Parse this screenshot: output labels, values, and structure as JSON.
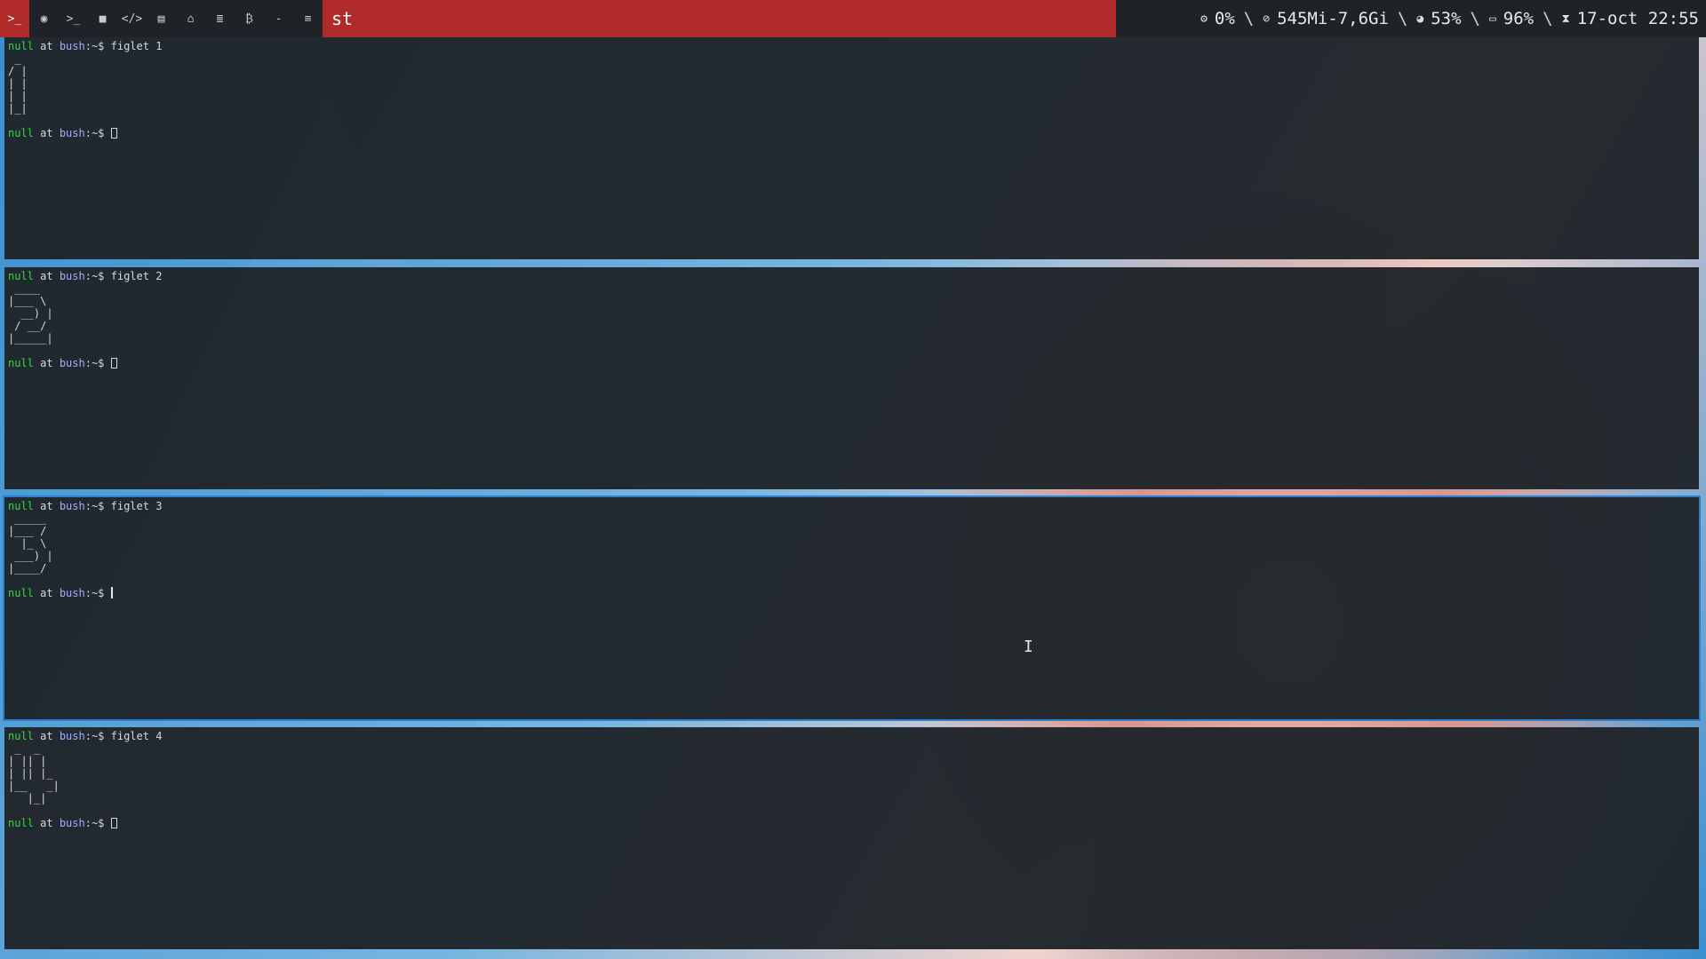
{
  "bar": {
    "tags": [
      {
        "name": "terminal-tag",
        "glyph": ">_",
        "active": true
      },
      {
        "name": "browser-tag",
        "glyph": "◉",
        "active": false
      },
      {
        "name": "shell-tag",
        "glyph": ">_",
        "active": false
      },
      {
        "name": "folder-tag",
        "glyph": "■",
        "active": false
      },
      {
        "name": "code-tag",
        "glyph": "</>",
        "active": false
      },
      {
        "name": "film-tag",
        "glyph": "▤",
        "active": false
      },
      {
        "name": "bank-tag",
        "glyph": "⌂",
        "active": false
      },
      {
        "name": "database-tag",
        "glyph": "≣",
        "active": false
      },
      {
        "name": "bitcoin-tag",
        "glyph": "₿",
        "active": false
      }
    ],
    "layout_symbol": "-",
    "menu_symbol": "≡",
    "window_title": "st",
    "status": {
      "cpu": "0%",
      "mem": "545Mi-7,6Gi",
      "disk": "53%",
      "battery": "96%",
      "datetime": "17-oct 22:55",
      "separator": "\\"
    }
  },
  "panes": [
    {
      "command": "figlet 1",
      "figlet": " _\n/ |\n| |\n| |\n|_|",
      "cursor": "box"
    },
    {
      "command": "figlet 2",
      "figlet": " ____\n|___ \\\n  __) |\n / __/\n|_____|",
      "cursor": "box"
    },
    {
      "command": "figlet 3",
      "figlet": " _____\n|___ /\n  |_ \\\n ___) |\n|____/",
      "cursor": "bar"
    },
    {
      "command": "figlet 4",
      "figlet": " _  _\n| || |\n| || |_\n|__   _|\n   |_|",
      "cursor": "box"
    }
  ],
  "prompt": {
    "user": "null",
    "at": " at ",
    "host": "bush",
    "path": ":~$ "
  },
  "colors": {
    "accent": "#b02a2a",
    "border": "#2d7fd0",
    "user": "#3ed33e",
    "host": "#a9a9ff"
  }
}
